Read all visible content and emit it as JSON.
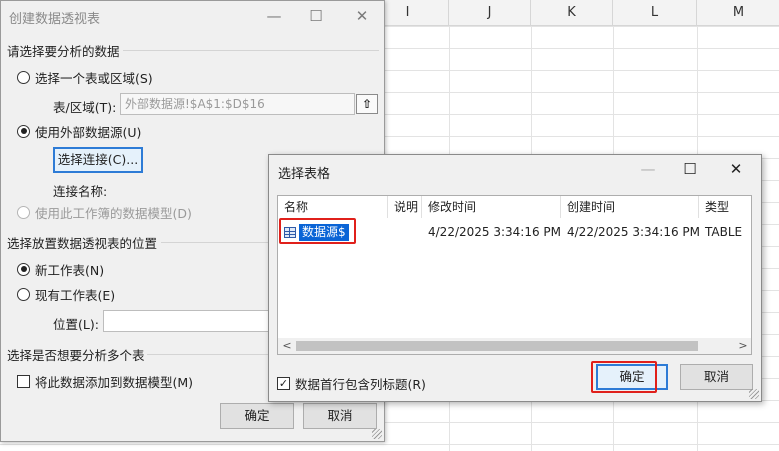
{
  "sheet": {
    "columns": [
      "I",
      "J",
      "K",
      "L",
      "M"
    ]
  },
  "main_dialog": {
    "title": "创建数据透视表",
    "minimize": "—",
    "maximize": "☐",
    "close": "✕",
    "section_analyze": "请选择要分析的数据",
    "opt_table_range": "选择一个表或区域(S)",
    "table_range_label": "表/区域(T):",
    "table_range_value": "外部数据源!$A$1:$D$16",
    "opt_external": "使用外部数据源(U)",
    "choose_connection": "选择连接(C)...",
    "connection_name_label": "连接名称:",
    "opt_data_model": "使用此工作簿的数据模型(D)",
    "section_location": "选择放置数据透视表的位置",
    "opt_new_sheet": "新工作表(N)",
    "opt_existing_sheet": "现有工作表(E)",
    "location_label": "位置(L):",
    "location_value": "",
    "section_multi": "选择是否想要分析多个表",
    "add_to_model": "将此数据添加到数据模型(M)",
    "ok": "确定",
    "cancel": "取消"
  },
  "select_dialog": {
    "title": "选择表格",
    "minimize": "—",
    "maximize": "☐",
    "close": "✕",
    "columns": [
      "名称",
      "说明",
      "修改时间",
      "创建时间",
      "类型"
    ],
    "rows": [
      {
        "name": "数据源$",
        "description": "",
        "modified": "4/22/2025 3:34:16 PM",
        "created": "4/22/2025 3:34:16 PM",
        "type": "TABLE"
      }
    ],
    "first_row_header": "数据首行包含列标题(R)",
    "first_row_header_checked": true,
    "ok": "确定",
    "cancel": "取消"
  },
  "colors": {
    "selection": "#0a64d6",
    "highlight_box": "#e0201b",
    "focus_border": "#2d7bd6"
  }
}
